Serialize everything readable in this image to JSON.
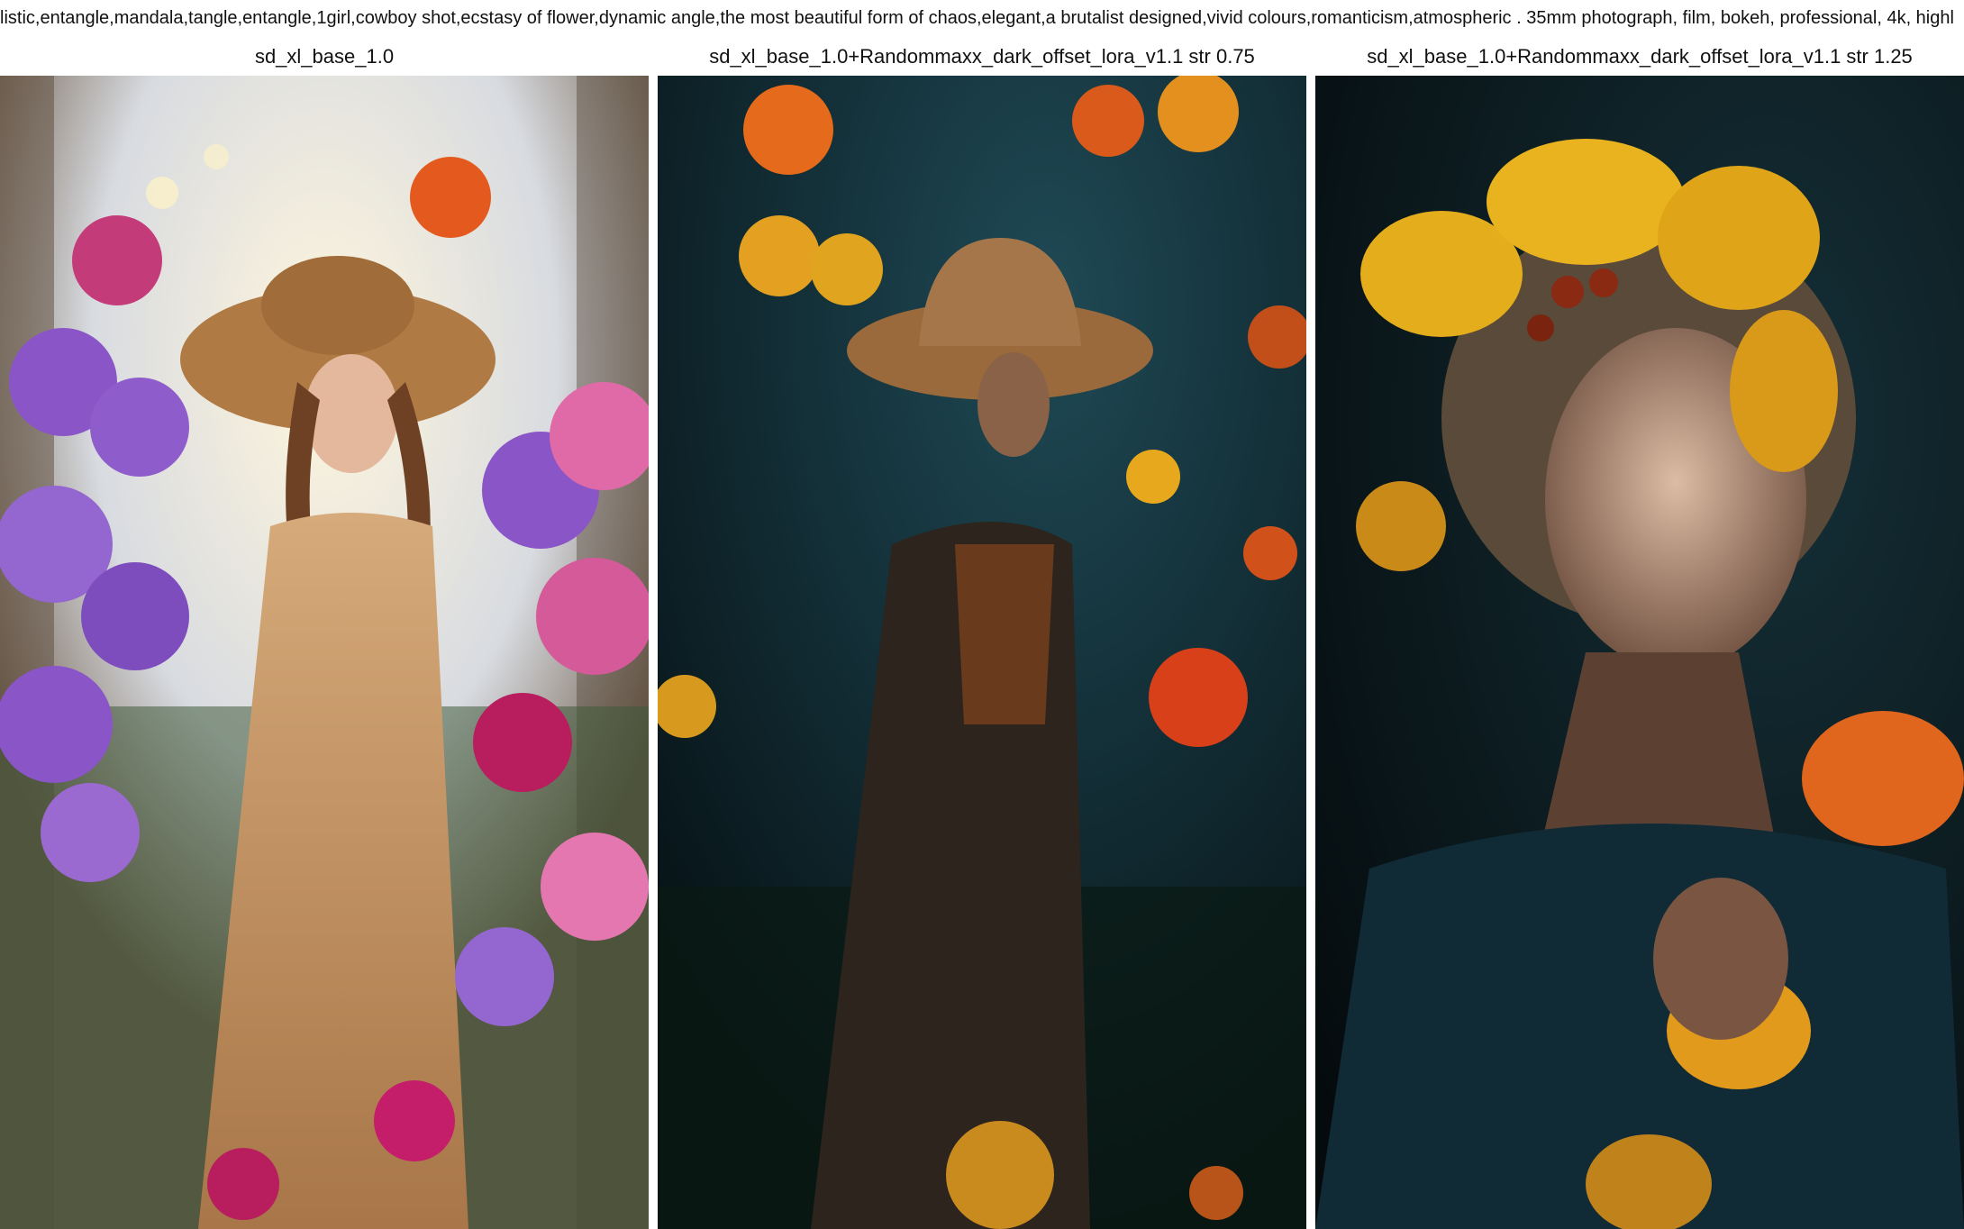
{
  "prompt_text": "listic,entangle,mandala,tangle,entangle,1girl,cowboy shot,ecstasy of flower,dynamic angle,the most beautiful form of chaos,elegant,a brutalist designed,vivid colours,romanticism,atmospheric . 35mm photograph, film, bokeh, professional, 4k, highl",
  "columns": [
    {
      "title": "sd_xl_base_1.0"
    },
    {
      "title": "sd_xl_base_1.0+Randommaxx_dark_offset_lora_v1.1 str 0.75"
    },
    {
      "title": "sd_xl_base_1.0+Randommaxx_dark_offset_lora_v1.1 str 1.25"
    }
  ],
  "colors": {
    "panel1_bg": "#e9e2cf",
    "panel1_flowers_purple": "#8a55c6",
    "panel1_flowers_pink": "#d45a9a",
    "panel1_dress": "#c99a6a",
    "panel1_hat": "#b07a45",
    "panel2_bg": "#0c1f26",
    "panel2_flower_orange": "#e66a1c",
    "panel2_flower_yellow": "#e3a021",
    "panel2_dress": "#3a2d22",
    "panel3_bg": "#0a1418",
    "panel3_flower_yellow": "#e4ad1c",
    "panel3_flower_orange": "#e0661e",
    "panel3_skin": "#c7a58e"
  }
}
